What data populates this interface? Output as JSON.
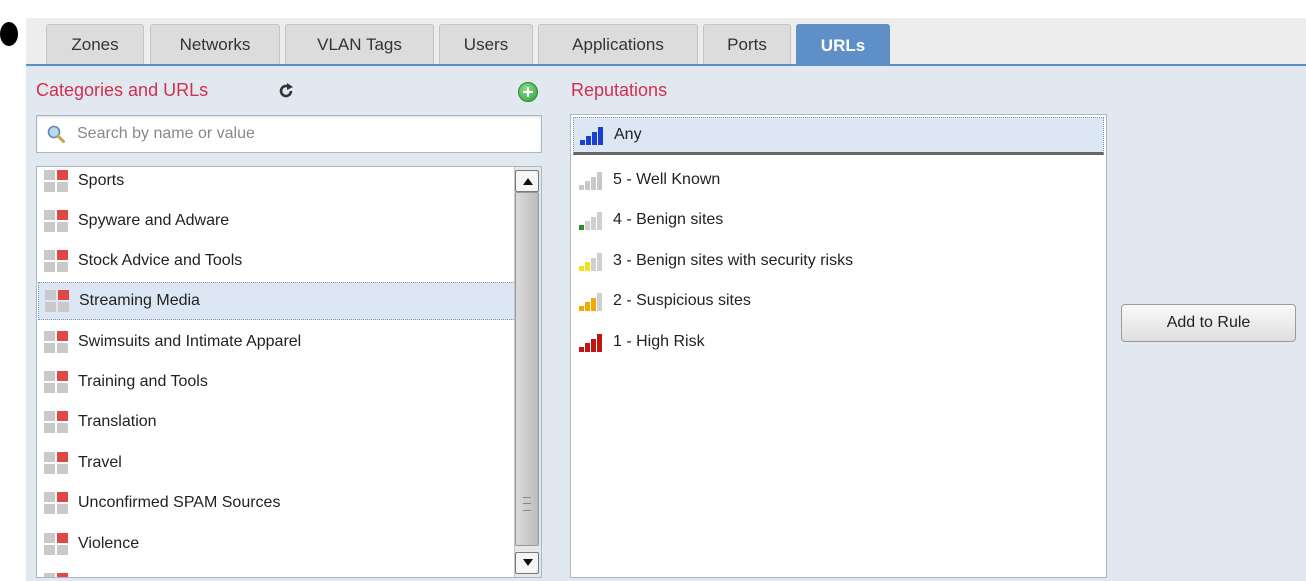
{
  "tabs": [
    {
      "label": "Zones",
      "active": false
    },
    {
      "label": "Networks",
      "active": false
    },
    {
      "label": "VLAN Tags",
      "active": false
    },
    {
      "label": "Users",
      "active": false
    },
    {
      "label": "Applications",
      "active": false
    },
    {
      "label": "Ports",
      "active": false
    },
    {
      "label": "URLs",
      "active": true
    }
  ],
  "categories": {
    "title": "Categories and URLs",
    "refresh_icon": "refresh-icon",
    "add_icon": "add-circle-icon",
    "search_placeholder": "Search by name or value",
    "items": [
      {
        "label": "Sports"
      },
      {
        "label": "Spyware and Adware"
      },
      {
        "label": "Stock Advice and Tools"
      },
      {
        "label": "Streaming Media",
        "selected": true
      },
      {
        "label": "Swimsuits and Intimate Apparel"
      },
      {
        "label": "Training and Tools"
      },
      {
        "label": "Translation"
      },
      {
        "label": "Travel"
      },
      {
        "label": "Unconfirmed SPAM Sources"
      },
      {
        "label": "Violence"
      }
    ]
  },
  "reputations": {
    "title": "Reputations",
    "items": [
      {
        "label": "Any",
        "color": "#1a3fd1",
        "level": 4,
        "selected": true
      },
      {
        "label": "5 - Well Known",
        "color": "#c8c8c8",
        "level": 5
      },
      {
        "label": "4 - Benign sites",
        "color": "#2e8b2e",
        "level": 1
      },
      {
        "label": "3 - Benign sites with security risks",
        "color": "#f2e21a",
        "level": 2
      },
      {
        "label": "2 - Suspicious sites",
        "color": "#f5a800",
        "level": 3
      },
      {
        "label": "1 - High Risk",
        "color": "#c01515",
        "level": 4
      }
    ]
  },
  "actions": {
    "add_to_rule": "Add to Rule"
  },
  "colors": {
    "accent": "#5e8fc6",
    "section_title": "#d03050",
    "panel_bg": "#e1e8ef"
  }
}
